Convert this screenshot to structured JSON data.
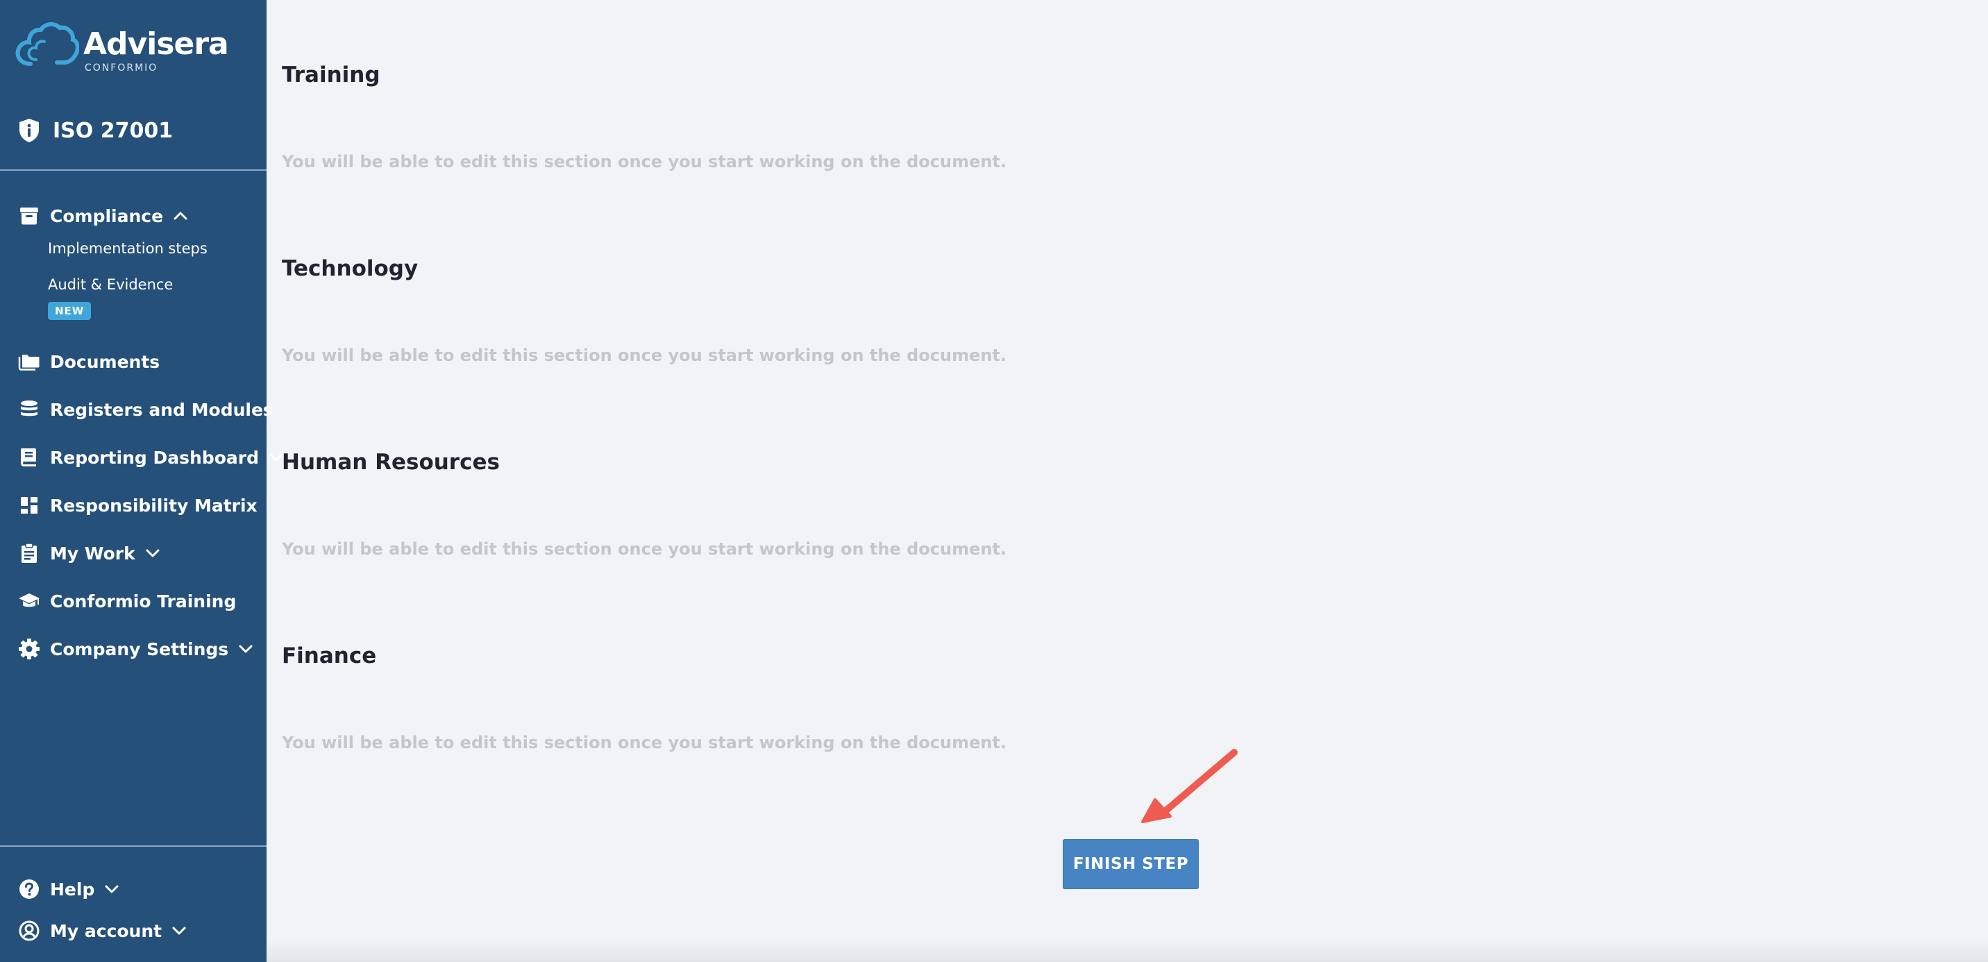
{
  "brand": {
    "name": "Advisera",
    "product_line": "CONFORMIO"
  },
  "product": {
    "label": "ISO 27001",
    "icon": "shield-info-icon"
  },
  "sidebar": {
    "nav": [
      {
        "label": "Compliance",
        "icon": "archive-icon",
        "expanded": true
      },
      {
        "label": "Documents",
        "icon": "folder-icon"
      },
      {
        "label": "Registers and Modules",
        "icon": "database-icon"
      },
      {
        "label": "Reporting Dashboard",
        "icon": "report-icon",
        "expanded": false
      },
      {
        "label": "Responsibility Matrix",
        "icon": "dashboard-grid-icon"
      },
      {
        "label": "My Work",
        "icon": "clipboard-icon",
        "expanded": false
      },
      {
        "label": "Conformio Training",
        "icon": "graduation-cap-icon"
      },
      {
        "label": "Company Settings",
        "icon": "gear-icon",
        "expanded": false
      }
    ],
    "compliance_sub": [
      {
        "label": "Implementation steps"
      },
      {
        "label": "Audit & Evidence",
        "badge": "NEW"
      }
    ],
    "footer": [
      {
        "label": "Help",
        "icon": "question-icon"
      },
      {
        "label": "My account",
        "icon": "user-circle-icon"
      }
    ]
  },
  "main": {
    "sections": [
      {
        "title": "Training",
        "note": "You will be able to edit this section once you start working on the document."
      },
      {
        "title": "Technology",
        "note": "You will be able to edit this section once you start working on the document."
      },
      {
        "title": "Human Resources",
        "note": "You will be able to edit this section once you start working on the document."
      },
      {
        "title": "Finance",
        "note": "You will be able to edit this section once you start working on the document."
      }
    ],
    "finish_button": "FINISH STEP"
  },
  "colors": {
    "sidebar_bg": "#255079",
    "page_bg": "#f2f3f7",
    "button_bg": "#4784c3",
    "badge_bg": "#3fa6d9",
    "arrow": "#ef5b50"
  }
}
